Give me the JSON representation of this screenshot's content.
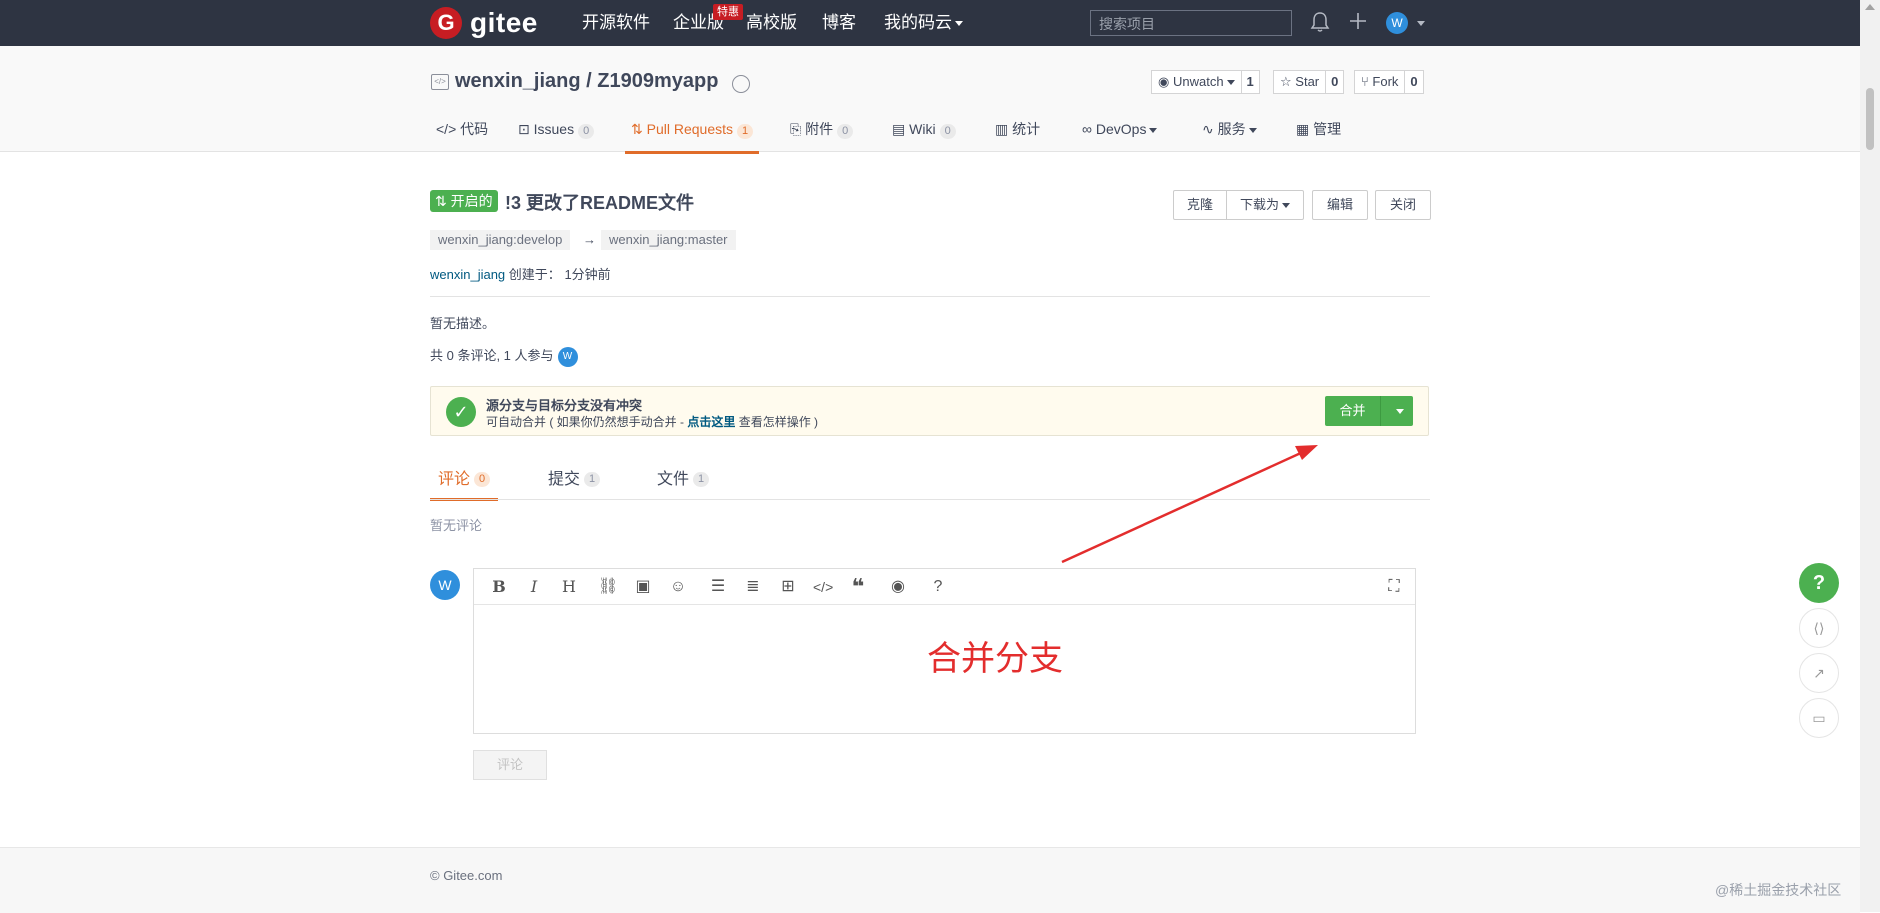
{
  "topnav": {
    "logo_text": "gitee",
    "items": [
      "开源软件",
      "企业版",
      "高校版",
      "博客",
      "我的码云"
    ],
    "badge": "特惠",
    "search_placeholder": "搜索项目",
    "avatar_letter": "W"
  },
  "repo": {
    "title": "wenxin_jiang / Z1909myapp",
    "unwatch": {
      "label": "Unwatch",
      "count": "1"
    },
    "star": {
      "label": "Star",
      "count": "0"
    },
    "fork": {
      "label": "Fork",
      "count": "0"
    },
    "tabs": [
      {
        "label": "代码"
      },
      {
        "label": "Issues",
        "count": "0"
      },
      {
        "label": "Pull Requests",
        "count": "1"
      },
      {
        "label": "附件",
        "count": "0"
      },
      {
        "label": "Wiki",
        "count": "0"
      },
      {
        "label": "统计"
      },
      {
        "label": "DevOps"
      },
      {
        "label": "服务"
      },
      {
        "label": "管理"
      }
    ]
  },
  "pr": {
    "status": "开启的",
    "title": "!3 更改了README文件",
    "buttons": {
      "clone": "克隆",
      "download": "下载为",
      "edit": "编辑",
      "close": "关闭"
    },
    "source_branch": "wenxin_jiang:develop",
    "arrow": "→",
    "target_branch": "wenxin_jiang:master",
    "author": "wenxin_jiang",
    "created_label": "创建于：",
    "created_time": "1分钟前",
    "description": "暂无描述。",
    "participants": "共 0 条评论, 1 人参与",
    "participant_avatar": "W"
  },
  "merge": {
    "title": "源分支与目标分支没有冲突",
    "sub_prefix": "可自动合并 ( 如果你仍然想手动合并 - ",
    "sub_link": "点击这里",
    "sub_suffix": " 查看怎样操作 )",
    "button": "合并"
  },
  "content_tabs": [
    {
      "label": "评论",
      "count": "0"
    },
    {
      "label": "提交",
      "count": "1"
    },
    {
      "label": "文件",
      "count": "1"
    }
  ],
  "no_comment": "暂无评论",
  "editor": {
    "avatar": "W",
    "annotation": "合并分支",
    "submit": "评论",
    "toolbar": [
      "bold-icon",
      "italic-icon",
      "heading-icon",
      "link-icon",
      "image-icon",
      "emoji-icon",
      "bullet-list-icon",
      "ordered-list-icon",
      "table-icon",
      "code-icon",
      "quote-icon",
      "preview-icon",
      "help-icon",
      "fullscreen-icon"
    ]
  },
  "footer": {
    "copyright": "© Gitee.com",
    "watermark": "@稀土掘金技术社区"
  },
  "floating": {
    "help": "?"
  },
  "colors": {
    "nav_bg": "#2e3442",
    "accent": "#e06c2a",
    "success": "#4cb050",
    "brand": "#c71d23",
    "annotation": "#e32d2d"
  }
}
